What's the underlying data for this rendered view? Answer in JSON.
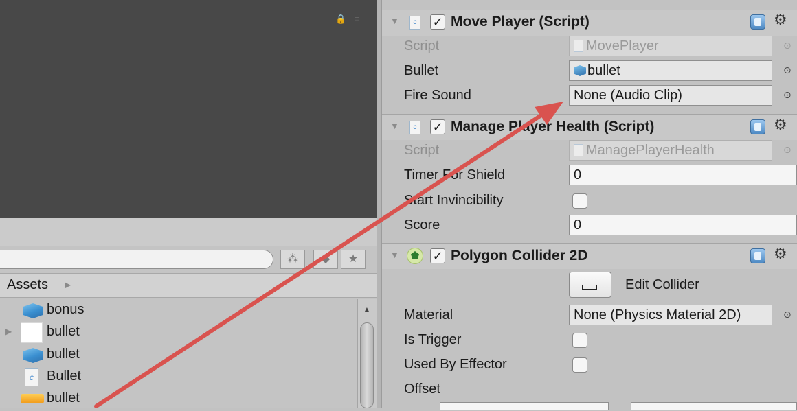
{
  "project": {
    "breadcrumb": "Assets",
    "assets": [
      {
        "name": "bonus",
        "icon": "prefab-cube-icon",
        "expandable": false
      },
      {
        "name": "bullet",
        "icon": "sprite-icon",
        "expandable": true
      },
      {
        "name": "bullet",
        "icon": "prefab-cube-icon",
        "expandable": false
      },
      {
        "name": "Bullet",
        "icon": "script-icon",
        "expandable": false
      },
      {
        "name": "bullet",
        "icon": "prefab-icon",
        "expandable": false
      }
    ]
  },
  "inspector": {
    "move_player": {
      "title": "Move Player (Script)",
      "script_label": "Script",
      "script_value": "MovePlayer",
      "bullet_label": "Bullet",
      "bullet_value": "bullet",
      "fire_sound_label": "Fire Sound",
      "fire_sound_value": "None (Audio Clip)"
    },
    "manage_health": {
      "title": "Manage Player Health (Script)",
      "script_label": "Script",
      "script_value": "ManagePlayerHealth",
      "timer_label": "Timer For Shield",
      "timer_value": "0",
      "invincibility_label": "Start Invincibility",
      "invincibility_checked": false,
      "score_label": "Score",
      "score_value": "0"
    },
    "polygon_collider": {
      "title": "Polygon Collider 2D",
      "edit_collider_label": "Edit Collider",
      "material_label": "Material",
      "material_value": "None (Physics Material 2D)",
      "is_trigger_label": "Is Trigger",
      "is_trigger_checked": false,
      "used_by_effector_label": "Used By Effector",
      "used_by_effector_checked": false,
      "offset_label": "Offset"
    }
  },
  "colors": {
    "scene_bg": "#484848",
    "inspector_bg": "#c2c2c2",
    "annotation_arrow": "#d9534f"
  }
}
